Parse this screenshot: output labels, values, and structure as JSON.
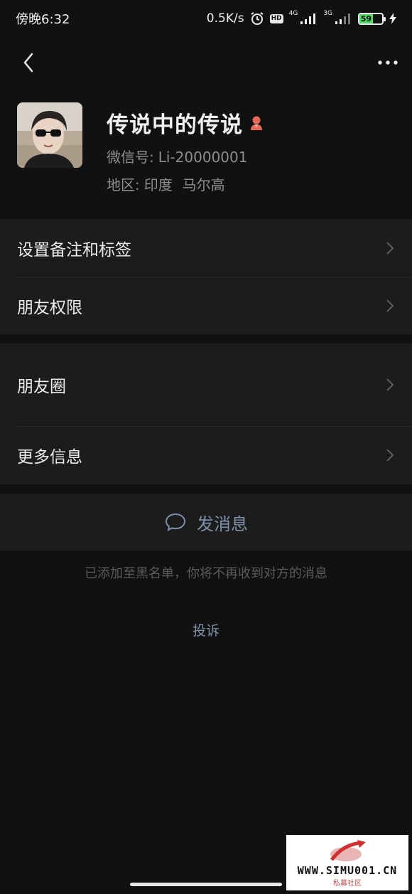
{
  "status_bar": {
    "time": "傍晚6:32",
    "speed": "0.5K/s",
    "hd": "HD",
    "net1": "4G",
    "net2": "3G",
    "battery": "59",
    "battery_level": 0.59
  },
  "profile": {
    "nickname": "传说中的传说",
    "wechat_id_label": "微信号:",
    "wechat_id": "Li-20000001",
    "region_label": "地区:",
    "region_country": "印度",
    "region_city": "马尔高"
  },
  "menu_group1": {
    "remark_tags": "设置备注和标签",
    "permissions": "朋友权限"
  },
  "menu_group2": {
    "moments": "朋友圈",
    "more_info": "更多信息"
  },
  "actions": {
    "send_message": "发消息",
    "blacklist_notice": "已添加至黑名单，你将不再收到对方的消息",
    "complain": "投诉"
  },
  "watermark": {
    "main": "WWW.SIMU001.CN",
    "sub": "私募社区"
  },
  "colors": {
    "background": "#111111",
    "card": "#1c1c1c",
    "link": "#7d90a9",
    "battery": "#4cd964"
  }
}
